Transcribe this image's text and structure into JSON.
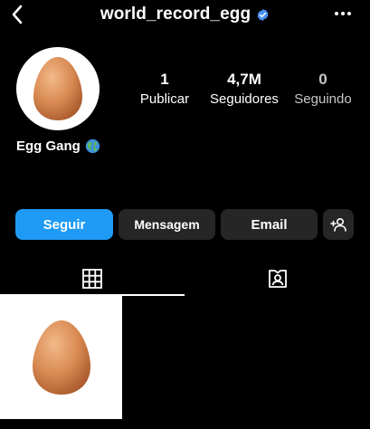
{
  "header": {
    "username": "world_record_egg",
    "verified": true
  },
  "icons": {
    "back": "chevron-left-icon",
    "verified": "verified-badge-icon",
    "more": "more-dots-icon",
    "grid": "grid-icon",
    "tagged": "tagged-user-icon",
    "add_person": "add-person-icon",
    "globe": "globe-emoji-icon"
  },
  "profile": {
    "display_name": "Egg Gang",
    "stats": [
      {
        "value": "1",
        "label": "Publicar"
      },
      {
        "value": "4,7M",
        "label": "Seguidores"
      },
      {
        "value": "0",
        "label": "Seguindo"
      }
    ]
  },
  "actions": {
    "follow": "Seguir",
    "message": "Mensagem",
    "email": "Email"
  },
  "colors": {
    "background": "#000000",
    "accent": "#1f9bf5",
    "button_secondary": "#262626",
    "verified": "#4a90f0"
  }
}
